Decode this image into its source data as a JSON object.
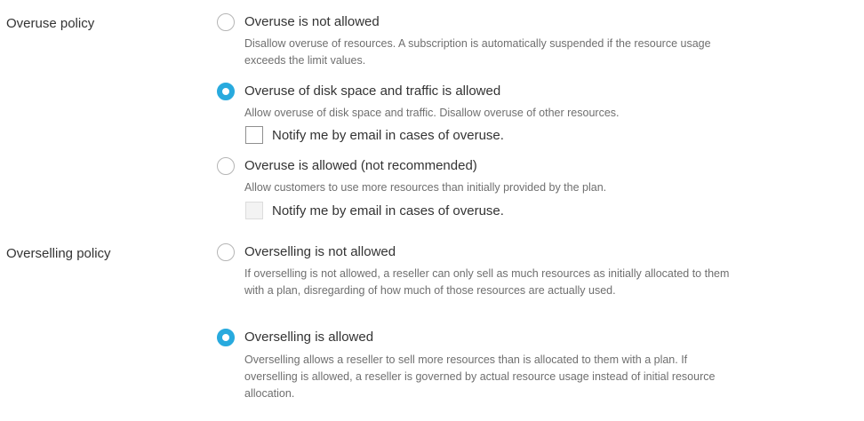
{
  "overuse": {
    "label": "Overuse policy",
    "options": [
      {
        "title": "Overuse is not allowed",
        "description": "Disallow overuse of resources. A subscription is automatically suspended if the resource usage exceeds the limit values.",
        "checked": false
      },
      {
        "title": "Overuse of disk space and traffic is allowed",
        "description": "Allow overuse of disk space and traffic. Disallow overuse of other resources.",
        "checked": true,
        "notify": {
          "label": "Notify me by email in cases of overuse.",
          "checked": false,
          "disabled": false
        }
      },
      {
        "title": "Overuse is allowed (not recommended)",
        "description": "Allow customers to use more resources than initially provided by the plan.",
        "checked": false,
        "notify": {
          "label": "Notify me by email in cases of overuse.",
          "checked": false,
          "disabled": true
        }
      }
    ]
  },
  "overselling": {
    "label": "Overselling policy",
    "options": [
      {
        "title": "Overselling is not allowed",
        "description": "If overselling is not allowed, a reseller can only sell as much resources as initially allocated to them with a plan, disregarding of how much of those resources are actually used.",
        "checked": false
      },
      {
        "title": "Overselling is allowed",
        "description": "Overselling allows a reseller to sell more resources than is allocated to them with a plan. If overselling is allowed, a reseller is governed by actual resource usage instead of initial resource allocation.",
        "checked": true
      }
    ]
  },
  "colors": {
    "accent": "#28aade",
    "text": "#333333",
    "description": "#6f6f6f"
  }
}
